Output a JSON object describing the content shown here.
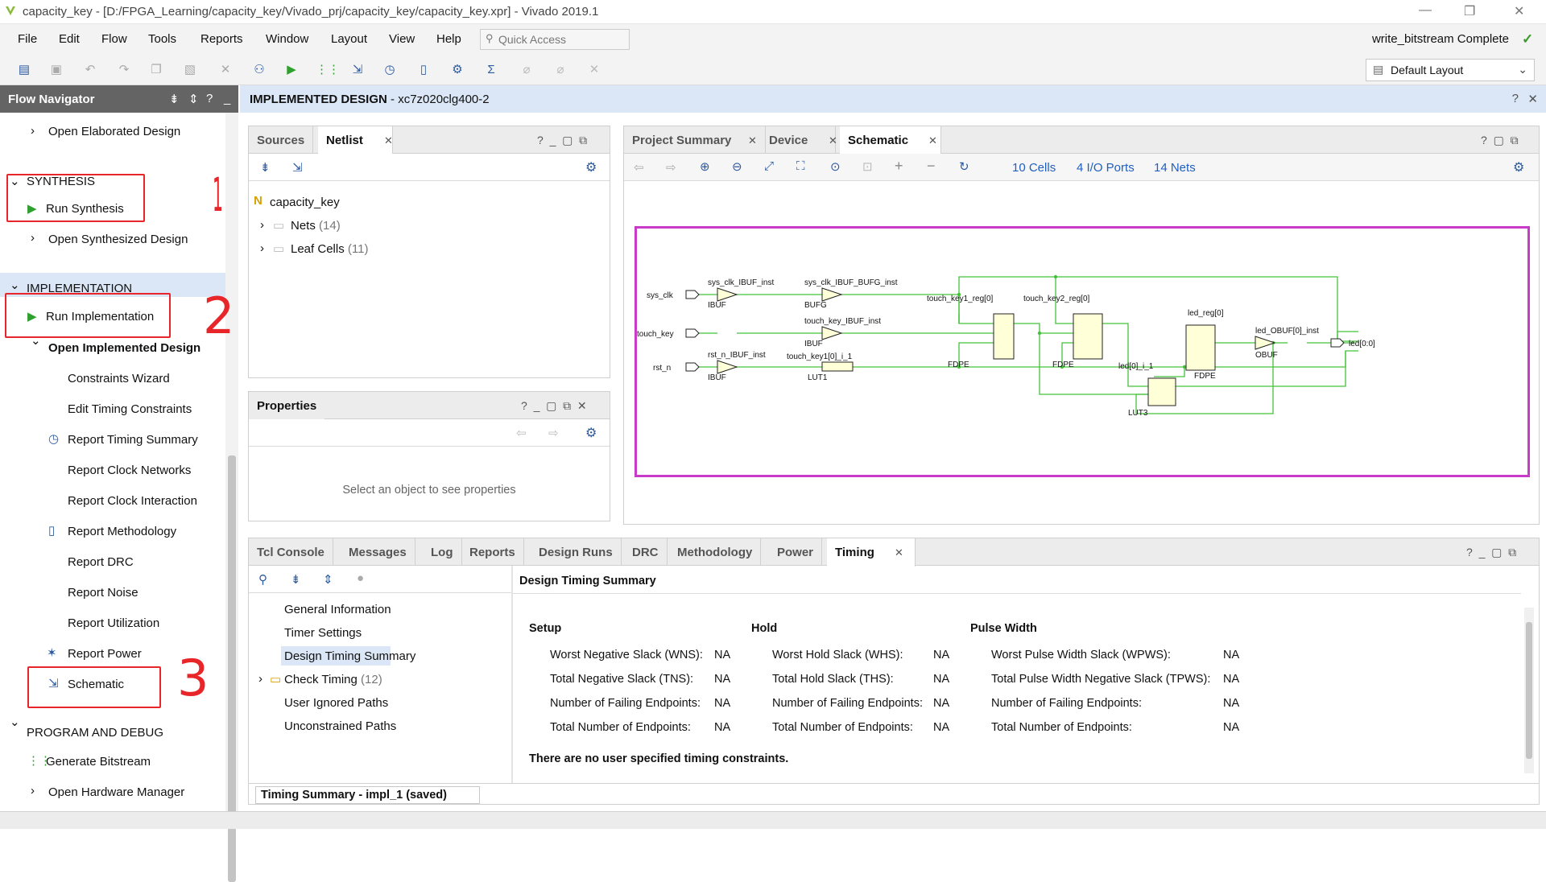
{
  "window": {
    "title": "capacity_key - [D:/FPGA_Learning/capacity_key/Vivado_prj/capacity_key/capacity_key.xpr] - Vivado 2019.1",
    "min": "—",
    "max": "❐",
    "close": "✕"
  },
  "menu": [
    "File",
    "Edit",
    "Flow",
    "Tools",
    "Reports",
    "Window",
    "Layout",
    "View",
    "Help"
  ],
  "quick_access": {
    "placeholder": "Quick Access"
  },
  "status": {
    "text": "write_bitstream Complete",
    "check": "✓"
  },
  "layout_select": {
    "value": "Default Layout"
  },
  "flow_navigator": {
    "title": "Flow Navigator",
    "items": {
      "open_elab": "Open Elaborated Design",
      "synthesis": "SYNTHESIS",
      "run_synth": "Run Synthesis",
      "open_synth": "Open Synthesized Design",
      "implementation": "IMPLEMENTATION",
      "run_impl": "Run Implementation",
      "open_impl": "Open Implemented Design",
      "constraints_wizard": "Constraints Wizard",
      "edit_timing": "Edit Timing Constraints",
      "report_timing": "Report Timing Summary",
      "report_clock_networks": "Report Clock Networks",
      "report_clock_interaction": "Report Clock Interaction",
      "report_methodology": "Report Methodology",
      "report_drc": "Report DRC",
      "report_noise": "Report Noise",
      "report_utilization": "Report Utilization",
      "report_power": "Report Power",
      "schematic": "Schematic",
      "program_debug": "PROGRAM AND DEBUG",
      "generate_bitstream": "Generate Bitstream",
      "open_hw": "Open Hardware Manager"
    },
    "annotations": [
      "1",
      "2",
      "3"
    ]
  },
  "main_header": {
    "title": "IMPLEMENTED DESIGN",
    "part": " - xc7z020clg400-2"
  },
  "netlist_panel": {
    "tabs": [
      "Sources",
      "Netlist"
    ],
    "root": "capacity_key",
    "nets": "Nets",
    "nets_count": "(14)",
    "leaf": "Leaf Cells",
    "leaf_count": "(11)"
  },
  "properties_panel": {
    "title": "Properties",
    "empty": "Select an object to see properties"
  },
  "schematic_panel": {
    "tabs": [
      "Project Summary",
      "Device",
      "Schematic"
    ],
    "cells": "10 Cells",
    "ports": "4 I/O Ports",
    "nets": "14 Nets"
  },
  "schematic": {
    "ports": [
      "sys_clk",
      "touch_key",
      "rst_n",
      "led[0:0]"
    ],
    "insts": [
      "sys_clk_IBUF_inst",
      "sys_clk_IBUF_BUFG_inst",
      "touch_key_IBUF_inst",
      "rst_n_IBUF_inst",
      "touch_key1[0]_i_1",
      "touch_key1_reg[0]",
      "touch_key2_reg[0]",
      "led[0]_i_1",
      "led_reg[0]",
      "led_OBUF[0]_inst"
    ],
    "types": [
      "IBUF",
      "BUFG",
      "IBUF",
      "IBUF",
      "LUT1",
      "FDPE",
      "FDPE",
      "LUT3",
      "FDPE",
      "OBUF"
    ]
  },
  "bottom_panel": {
    "tabs": [
      "Tcl Console",
      "Messages",
      "Log",
      "Reports",
      "Design Runs",
      "DRC",
      "Methodology",
      "Power",
      "Timing"
    ],
    "tree": [
      "General Information",
      "Timer Settings",
      "Design Timing Summary",
      "Check Timing",
      "User Ignored Paths",
      "Unconstrained Paths"
    ],
    "check_timing_count": "(12)",
    "heading": "Design Timing Summary",
    "setup": {
      "title": "Setup",
      "rows": [
        [
          "Worst Negative Slack (WNS):",
          "NA"
        ],
        [
          "Total Negative Slack (TNS):",
          "NA"
        ],
        [
          "Number of Failing Endpoints:",
          "NA"
        ],
        [
          "Total Number of Endpoints:",
          "NA"
        ]
      ]
    },
    "hold": {
      "title": "Hold",
      "rows": [
        [
          "Worst Hold Slack (WHS):",
          "NA"
        ],
        [
          "Total Hold Slack (THS):",
          "NA"
        ],
        [
          "Number of Failing Endpoints:",
          "NA"
        ],
        [
          "Total Number of Endpoints:",
          "NA"
        ]
      ]
    },
    "pulse": {
      "title": "Pulse Width",
      "rows": [
        [
          "Worst Pulse Width Slack (WPWS):",
          "NA"
        ],
        [
          "Total Pulse Width Negative Slack (TPWS):",
          "NA"
        ],
        [
          "Number of Failing Endpoints:",
          "NA"
        ],
        [
          "Total Number of Endpoints:",
          "NA"
        ]
      ]
    },
    "note": "There are no user specified timing constraints.",
    "summary_tab": "Timing Summary - impl_1 (saved)"
  }
}
